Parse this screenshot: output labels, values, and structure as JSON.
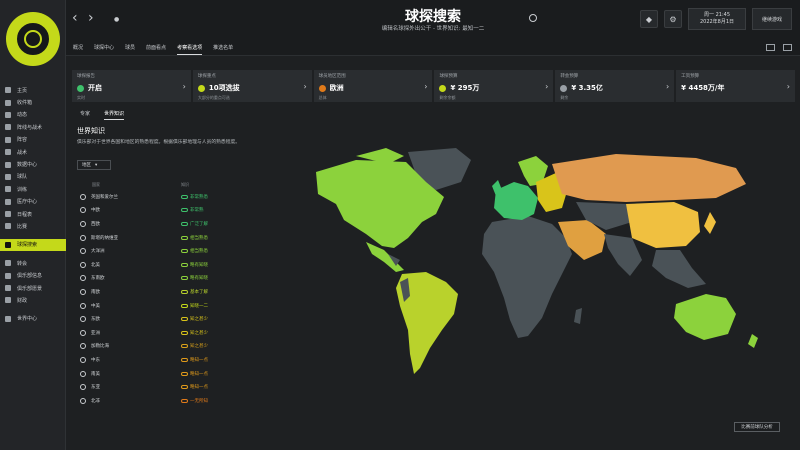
{
  "header": {
    "title": "球探搜索",
    "subtitle": "编辑名球探外出公干 - 世界知识: 最知一二",
    "clock_line1": "周一 21:45",
    "clock_line2": "2022年8月1日",
    "continue": "继续游戏"
  },
  "tabs": [
    "概况",
    "球探中心",
    "球员",
    "前面看点",
    "考察看选项",
    "推选名单"
  ],
  "sidebar": [
    "主页",
    "收件箱",
    "动态",
    "阵线与战术",
    "阵容",
    "战术",
    "数据中心",
    "球队",
    "训练",
    "医疗中心",
    "日程表",
    "比赛",
    "球探搜索",
    "转会",
    "俱乐部信息",
    "俱乐部愿景",
    "财政",
    "世界中心"
  ],
  "cards": [
    {
      "label": "球探报告",
      "value": "开启",
      "sub": "实时"
    },
    {
      "label": "球探重点",
      "value": "10项选拔",
      "sub": "大部分的重点可选"
    },
    {
      "label": "球员地区范围",
      "value": "欧洲",
      "sub": "总体"
    },
    {
      "label": "球探预算",
      "value": "¥ 295万",
      "sub": "剩余余额"
    },
    {
      "label": "转会预算",
      "value": "¥ 3.35亿",
      "sub": "剩余"
    },
    {
      "label": "工资预算",
      "value": "¥ 4458万/年",
      "sub": ""
    }
  ],
  "subtabs": [
    "专家",
    "世界知识"
  ],
  "section": {
    "title": "世界知识",
    "desc": "俱乐部对于世界各国和地区的熟悉程度。根据俱乐部地理与人员的熟悉程度。",
    "select": "地区"
  },
  "list_headers": {
    "region": "国家",
    "knowledge": "知识"
  },
  "regions": [
    {
      "name": "英国和爱尔兰",
      "k": "非常熟悉",
      "c": "#3ec16b"
    },
    {
      "name": "中欧",
      "k": "非常熟",
      "c": "#3ec16b"
    },
    {
      "name": "西欧",
      "k": "广泛了解",
      "c": "#3ec16b"
    },
    {
      "name": "斯堪的纳维亚",
      "k": "相当熟悉",
      "c": "#8cd23c"
    },
    {
      "name": "大洋洲",
      "k": "相当熟悉",
      "c": "#8cd23c"
    },
    {
      "name": "北美",
      "k": "略有知晓",
      "c": "#8cd23c"
    },
    {
      "name": "东南欧",
      "k": "略有知晓",
      "c": "#8cd23c"
    },
    {
      "name": "南欧",
      "k": "基本了解",
      "c": "#b9d22c"
    },
    {
      "name": "中美",
      "k": "知晓一二",
      "c": "#c4d91a"
    },
    {
      "name": "东欧",
      "k": "知之甚少",
      "c": "#d9c41a"
    },
    {
      "name": "亚洲",
      "k": "知之甚少",
      "c": "#d9c41a"
    },
    {
      "name": "加勒比海",
      "k": "知之甚少",
      "c": "#d9a11a"
    },
    {
      "name": "中东",
      "k": "略知一点",
      "c": "#e09a1a"
    },
    {
      "name": "南美",
      "k": "略知一点",
      "c": "#e09a1a"
    },
    {
      "name": "东亚",
      "k": "略知一点",
      "c": "#e09a1a"
    },
    {
      "name": "北非",
      "k": "一无所知",
      "c": "#e07a1a"
    }
  ],
  "footer": {
    "button": "比赛前球队分析"
  },
  "colors": {
    "accent": "#c4d91a"
  }
}
